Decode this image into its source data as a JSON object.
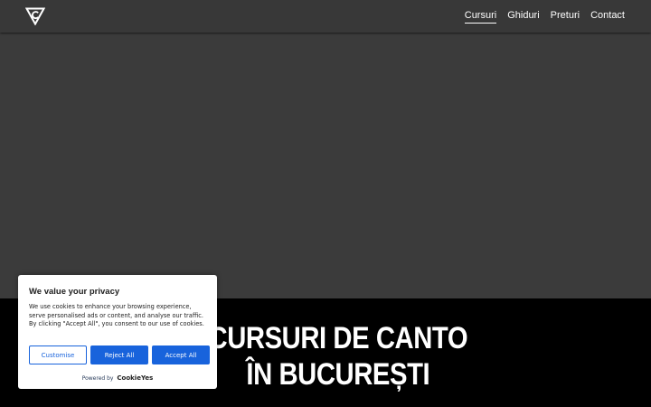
{
  "header": {
    "logo_icon": "triangle-c-logo",
    "nav": [
      {
        "label": "Cursuri",
        "active": true
      },
      {
        "label": "Ghiduri",
        "active": false
      },
      {
        "label": "Preturi",
        "active": false
      },
      {
        "label": "Contact",
        "active": false
      }
    ]
  },
  "hero": {
    "title_line1": "CURSURI DE CANTO",
    "title_line2": "ÎN BUCUREȘTI"
  },
  "cookie_banner": {
    "title": "We value your privacy",
    "text": "We use cookies to enhance your browsing experience, serve personalised ads or content, and analyse our traffic. By clicking \"Accept All\", you consent to our use of cookies.",
    "buttons": {
      "customise": "Customise",
      "reject": "Reject All",
      "accept": "Accept All"
    },
    "powered_by": "Powered by",
    "brand": "CookieYes",
    "accent_color": "#1863dc"
  },
  "colors": {
    "header_bg": "#383838",
    "hero_image_bg": "#3b3b3b",
    "hero_band_bg": "#000000",
    "text_light": "#ffffff"
  }
}
